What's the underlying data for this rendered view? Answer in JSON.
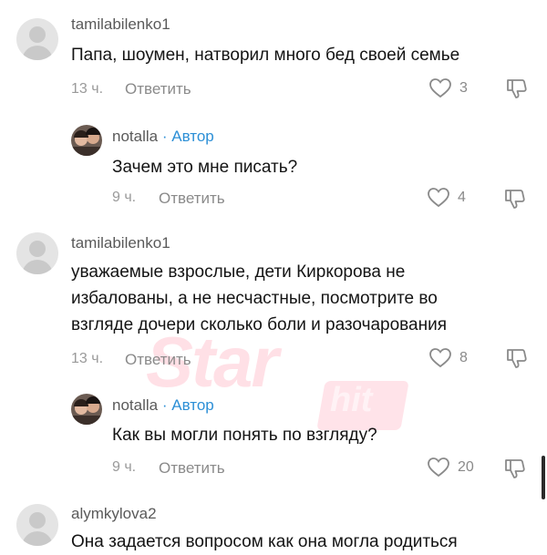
{
  "comments": [
    {
      "username": "tamilabilenko1",
      "text": "Папа, шоумен, натворил много бед своей семье",
      "time": "13 ч.",
      "reply_label": "Ответить",
      "likes": "3"
    },
    {
      "username": "notalla",
      "author_tag": "· Автор",
      "text": "Зачем это мне писать?",
      "time": "9 ч.",
      "reply_label": "Ответить",
      "likes": "4"
    },
    {
      "username": "tamilabilenko1",
      "text_lines": [
        "уважаемые взрослые, дети Киркорова не",
        "избалованы, а не несчастные, посмотрите во",
        "взгляде дочери сколько боли и разочарования"
      ],
      "time": "13 ч.",
      "reply_label": "Ответить",
      "likes": "8"
    },
    {
      "username": "notalla",
      "author_tag": "· Автор",
      "text": "Как вы могли понять по взгляду?",
      "time": "9 ч.",
      "reply_label": "Ответить",
      "likes": "20"
    },
    {
      "username": "alymkylova2",
      "text": "Она задается вопросом как она могла родиться"
    }
  ],
  "watermark": {
    "line1": "Star",
    "line2": "hit"
  },
  "colors": {
    "author_tag": "#2c8fd6",
    "watermark": "#ff1b48"
  },
  "icons": {
    "like": "heart-outline-icon",
    "dislike": "thumbs-down-icon"
  }
}
